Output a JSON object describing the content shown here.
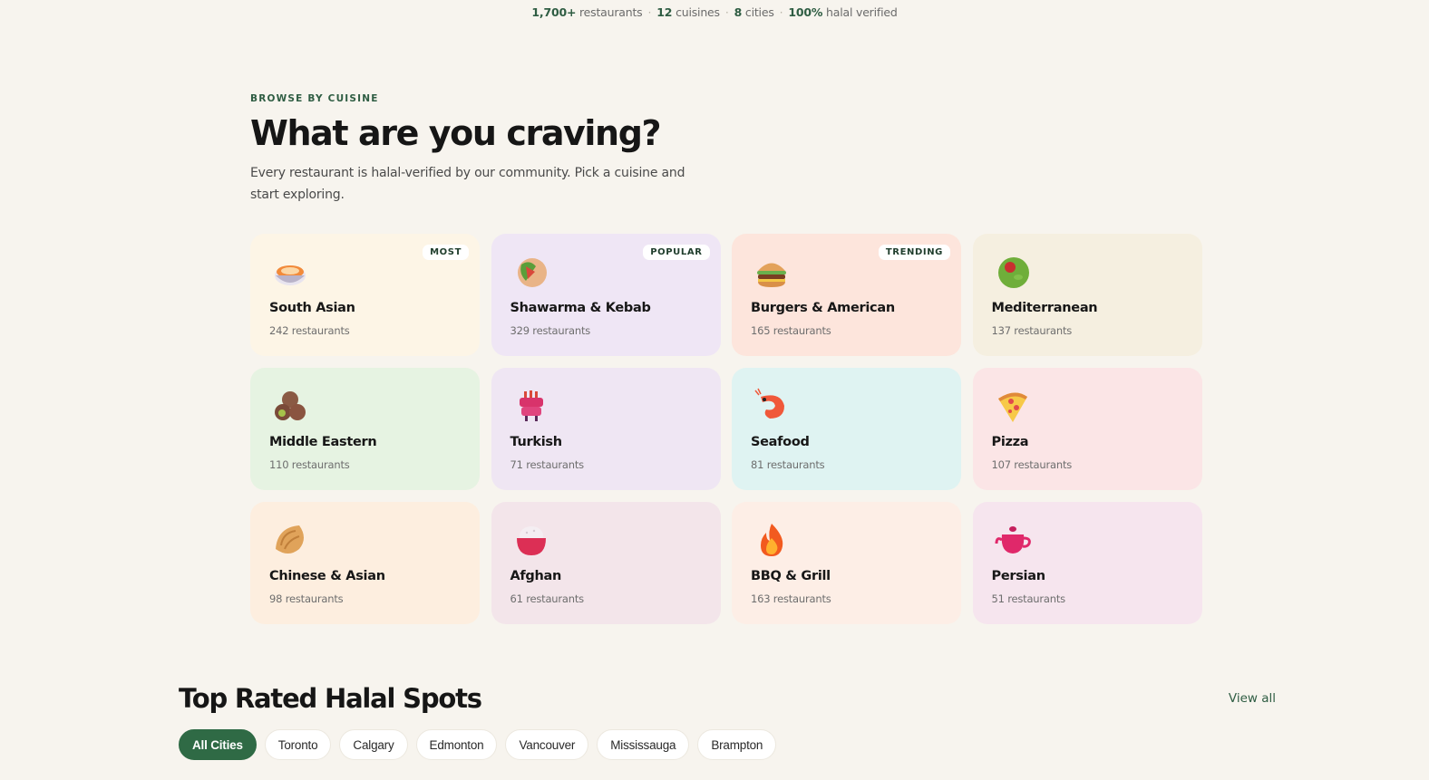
{
  "stats": [
    {
      "value": "1,700+",
      "label": "restaurants"
    },
    {
      "value": "12",
      "label": "cuisines"
    },
    {
      "value": "8",
      "label": "cities"
    },
    {
      "value": "100%",
      "label": "halal verified"
    }
  ],
  "browse": {
    "eyebrow": "BROWSE BY CUISINE",
    "heading": "What are you craving?",
    "subtitle": "Every restaurant is halal-verified by our community. Pick a cuisine and start exploring."
  },
  "cuisines": [
    {
      "name": "South Asian",
      "count": "242 restaurants",
      "badge": "MOST",
      "icon": "curry-bowl-icon",
      "bg": "#fdf5e6"
    },
    {
      "name": "Shawarma & Kebab",
      "count": "329 restaurants",
      "badge": "POPULAR",
      "icon": "shawarma-wrap-icon",
      "bg": "#efe6f5"
    },
    {
      "name": "Burgers & American",
      "count": "165 restaurants",
      "badge": "TRENDING",
      "icon": "burger-icon",
      "bg": "#fde5dc"
    },
    {
      "name": "Mediterranean",
      "count": "137 restaurants",
      "badge": "",
      "icon": "olive-icon",
      "bg": "#f5efe0"
    },
    {
      "name": "Middle Eastern",
      "count": "110 restaurants",
      "badge": "",
      "icon": "falafel-icon",
      "bg": "#e6f3e2"
    },
    {
      "name": "Turkish",
      "count": "71 restaurants",
      "badge": "",
      "icon": "doner-grill-icon",
      "bg": "#efe6f3"
    },
    {
      "name": "Seafood",
      "count": "81 restaurants",
      "badge": "",
      "icon": "shrimp-icon",
      "bg": "#dff3f2"
    },
    {
      "name": "Pizza",
      "count": "107 restaurants",
      "badge": "",
      "icon": "pizza-slice-icon",
      "bg": "#fbe5e6"
    },
    {
      "name": "Chinese & Asian",
      "count": "98 restaurants",
      "badge": "",
      "icon": "dumpling-icon",
      "bg": "#fdeedf"
    },
    {
      "name": "Afghan",
      "count": "61 restaurants",
      "badge": "",
      "icon": "rice-bowl-icon",
      "bg": "#f3e5ea"
    },
    {
      "name": "BBQ & Grill",
      "count": "163 restaurants",
      "badge": "",
      "icon": "fire-icon",
      "bg": "#fdeee6"
    },
    {
      "name": "Persian",
      "count": "51 restaurants",
      "badge": "",
      "icon": "teapot-icon",
      "bg": "#f6e5ee"
    }
  ],
  "top_rated": {
    "heading": "Top Rated Halal Spots",
    "view_all": "View all",
    "cities": [
      "All Cities",
      "Toronto",
      "Calgary",
      "Edmonton",
      "Vancouver",
      "Mississauga",
      "Brampton"
    ],
    "active_city": "All Cities"
  }
}
